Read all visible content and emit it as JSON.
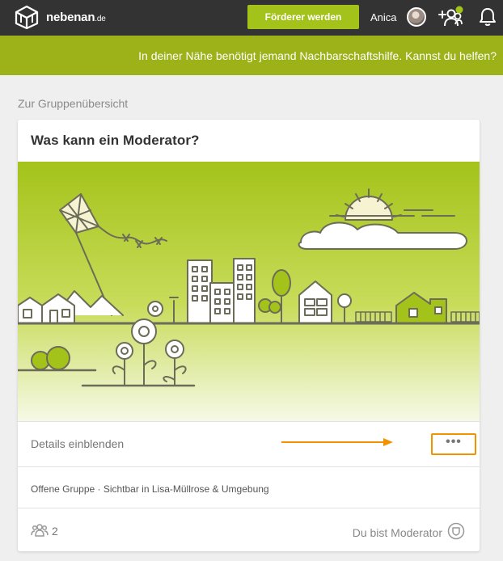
{
  "header": {
    "brand_name": "nebenan",
    "brand_tld": ".de",
    "cta_label": "Förderer werden",
    "username": "Anica",
    "brand_color": "#a4c31a",
    "icons": [
      "house-logo-icon",
      "avatar",
      "invite-neighbor-icon",
      "bell-icon"
    ]
  },
  "banner": {
    "text": "In deiner Nähe benötigt jemand Nachbarschaftshilfe. Kannst du helfen?"
  },
  "page": {
    "back_link": "Zur Gruppenübersicht"
  },
  "group_card": {
    "title": "Was kann ein Moderator?",
    "details_link": "Details einblenden",
    "more_label": "•••",
    "info": "Offene Gruppe · Sichtbar in Lisa-Müllrose & Umgebung",
    "member_count": "2",
    "moderator_label": "Du bist Moderator",
    "highlight_color": "#f39200",
    "illustration_color": "#a4c31a"
  }
}
